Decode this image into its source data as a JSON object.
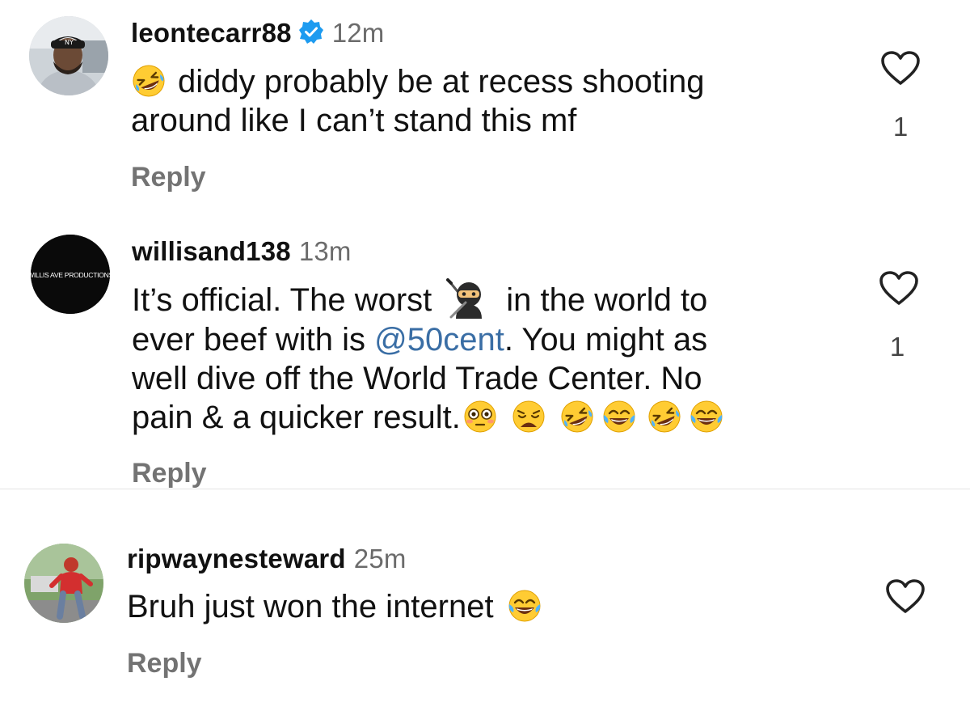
{
  "comments": [
    {
      "username": "leontecarr88",
      "verified": true,
      "time": "12m",
      "lines": [
        "diddy probably be at recess shooting",
        "around like I can’t stand this mf"
      ],
      "likes": "1",
      "reply_label": "Reply"
    },
    {
      "username": "willisand138",
      "verified": false,
      "time": "13m",
      "avatar_text": "WILLIS AVE PRODUCTIONS",
      "line1_before": "It’s official. The worst",
      "line1_after": "in the world to",
      "line2_before": "ever beef with is",
      "mention": "@50cent",
      "line2_after": ". You might as",
      "line3": "well dive off the World Trade Center. No",
      "line4": "pain & a quicker result.",
      "likes": "1",
      "reply_label": "Reply"
    },
    {
      "username": "ripwaynesteward",
      "verified": false,
      "time": "25m",
      "lines": [
        "Bruh just won the internet"
      ],
      "reply_label": "Reply"
    }
  ],
  "colors": {
    "mention": "#3a6ea5",
    "verified_badge": "#1d9bf0",
    "meta_gray": "#737373"
  },
  "icons": [
    "heart-outline-icon",
    "verified-badge-icon",
    "rolling-laughing-emoji",
    "ninja-emoji",
    "flushed-emoji",
    "weary-emoji",
    "tears-of-joy-emoji"
  ]
}
